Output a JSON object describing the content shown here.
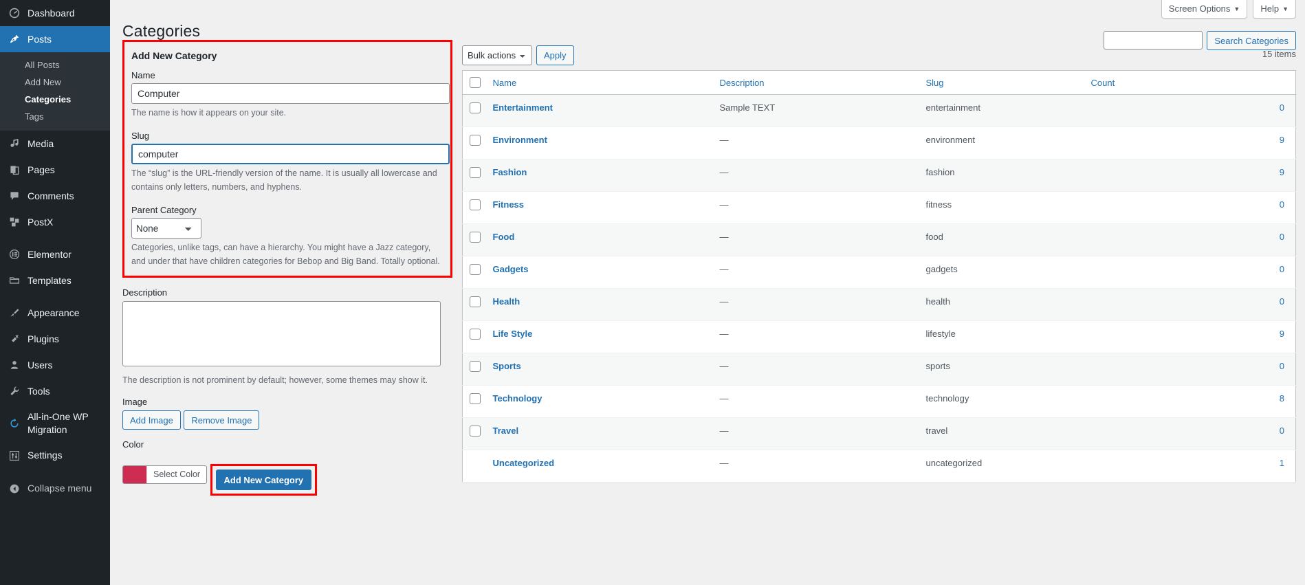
{
  "sidebar": {
    "items": [
      {
        "label": "Dashboard",
        "icon": "dashboard-icon",
        "glyph": "◉"
      },
      {
        "label": "Posts",
        "icon": "pin-icon",
        "glyph": "📌",
        "current": true
      },
      {
        "label": "Media",
        "icon": "media-icon",
        "glyph": "♪"
      },
      {
        "label": "Pages",
        "icon": "pages-icon",
        "glyph": "❐"
      },
      {
        "label": "Comments",
        "icon": "comments-icon",
        "glyph": "🗨"
      },
      {
        "label": "PostX",
        "icon": "postx-icon",
        "glyph": "❏"
      },
      {
        "label": "Elementor",
        "icon": "elementor-icon",
        "glyph": "Ⓔ"
      },
      {
        "label": "Templates",
        "icon": "folder-icon",
        "glyph": "🗀"
      },
      {
        "label": "Appearance",
        "icon": "brush-icon",
        "glyph": "🖌"
      },
      {
        "label": "Plugins",
        "icon": "plug-icon",
        "glyph": "🔌"
      },
      {
        "label": "Users",
        "icon": "user-icon",
        "glyph": "👤"
      },
      {
        "label": "Tools",
        "icon": "wrench-icon",
        "glyph": "🔧"
      },
      {
        "label": "All-in-One WP Migration",
        "icon": "migration-icon",
        "glyph": "⟳"
      },
      {
        "label": "Settings",
        "icon": "settings-icon",
        "glyph": "⇅"
      }
    ],
    "submenu": [
      {
        "label": "All Posts",
        "active": false
      },
      {
        "label": "Add New",
        "active": false
      },
      {
        "label": "Categories",
        "active": true
      },
      {
        "label": "Tags",
        "active": false
      }
    ],
    "collapse": {
      "label": "Collapse menu",
      "icon": "collapse-arrow-icon",
      "glyph": "◀"
    }
  },
  "header": {
    "title": "Categories",
    "screen_options": "Screen Options",
    "help": "Help",
    "caret": "▼"
  },
  "search": {
    "value": "",
    "placeholder": "",
    "button_label": "Search Categories"
  },
  "form": {
    "heading": "Add New Category",
    "name_label": "Name",
    "name_value": "Computer",
    "name_help": "The name is how it appears on your site.",
    "slug_label": "Slug",
    "slug_value": "computer",
    "slug_help": "The “slug” is the URL-friendly version of the name. It is usually all lowercase and contains only letters, numbers, and hyphens.",
    "parent_label": "Parent Category",
    "parent_value": "None",
    "parent_options": [
      "None"
    ],
    "parent_help": "Categories, unlike tags, can have a hierarchy. You might have a Jazz category, and under that have children categories for Bebop and Big Band. Totally optional.",
    "description_label": "Description",
    "description_value": "",
    "description_help": "The description is not prominent by default; however, some themes may show it.",
    "image_label": "Image",
    "add_image_label": "Add Image",
    "remove_image_label": "Remove Image",
    "color_label": "Color",
    "color_swatch_hex": "#CE2C51",
    "select_color_label": "Select Color",
    "submit_label": "Add New Category"
  },
  "tablenav": {
    "bulk_actions_value": "Bulk actions",
    "bulk_actions_options": [
      "Bulk actions"
    ],
    "apply_label": "Apply",
    "items_count": "15 items"
  },
  "table": {
    "columns": [
      "Name",
      "Description",
      "Slug",
      "Count"
    ],
    "rows": [
      {
        "name": "Entertainment",
        "description": "Sample TEXT",
        "slug": "entertainment",
        "count": "0",
        "has_checkbox": true
      },
      {
        "name": "Environment",
        "description": "—",
        "slug": "environment",
        "count": "9",
        "has_checkbox": true
      },
      {
        "name": "Fashion",
        "description": "—",
        "slug": "fashion",
        "count": "9",
        "has_checkbox": true
      },
      {
        "name": "Fitness",
        "description": "—",
        "slug": "fitness",
        "count": "0",
        "has_checkbox": true
      },
      {
        "name": "Food",
        "description": "—",
        "slug": "food",
        "count": "0",
        "has_checkbox": true
      },
      {
        "name": "Gadgets",
        "description": "—",
        "slug": "gadgets",
        "count": "0",
        "has_checkbox": true
      },
      {
        "name": "Health",
        "description": "—",
        "slug": "health",
        "count": "0",
        "has_checkbox": true
      },
      {
        "name": "Life Style",
        "description": "—",
        "slug": "lifestyle",
        "count": "9",
        "has_checkbox": true
      },
      {
        "name": "Sports",
        "description": "—",
        "slug": "sports",
        "count": "0",
        "has_checkbox": true
      },
      {
        "name": "Technology",
        "description": "—",
        "slug": "technology",
        "count": "8",
        "has_checkbox": true
      },
      {
        "name": "Travel",
        "description": "—",
        "slug": "travel",
        "count": "0",
        "has_checkbox": true
      },
      {
        "name": "Uncategorized",
        "description": "—",
        "slug": "uncategorized",
        "count": "1",
        "has_checkbox": false
      }
    ]
  },
  "colors": {
    "accent": "#2271b1",
    "sidebar_bg": "#1d2327",
    "highlight": "#ff0000"
  }
}
